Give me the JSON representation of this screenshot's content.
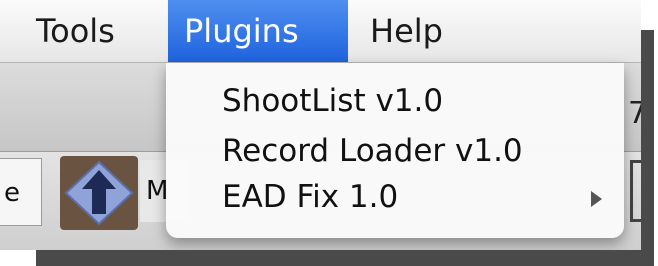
{
  "menubar": {
    "items": [
      {
        "label": "Tools"
      },
      {
        "label": "Plugins"
      },
      {
        "label": "Help"
      }
    ]
  },
  "plugins_menu": {
    "items": [
      {
        "label": "ShootList v1.0",
        "has_submenu": false
      },
      {
        "label": "Record Loader v1.0",
        "has_submenu": false
      },
      {
        "label": "EAD Fix 1.0",
        "has_submenu": true
      }
    ]
  },
  "toolbar": {
    "left_fragment": "e",
    "m_fragment": "M",
    "right_fragment": "7"
  },
  "icons": {
    "logo": "arrow-up-diamond-icon",
    "submenu": "triangle-right-icon"
  },
  "colors": {
    "menu_highlight": "#2a6ee6",
    "logo_bg": "#6b5342"
  }
}
